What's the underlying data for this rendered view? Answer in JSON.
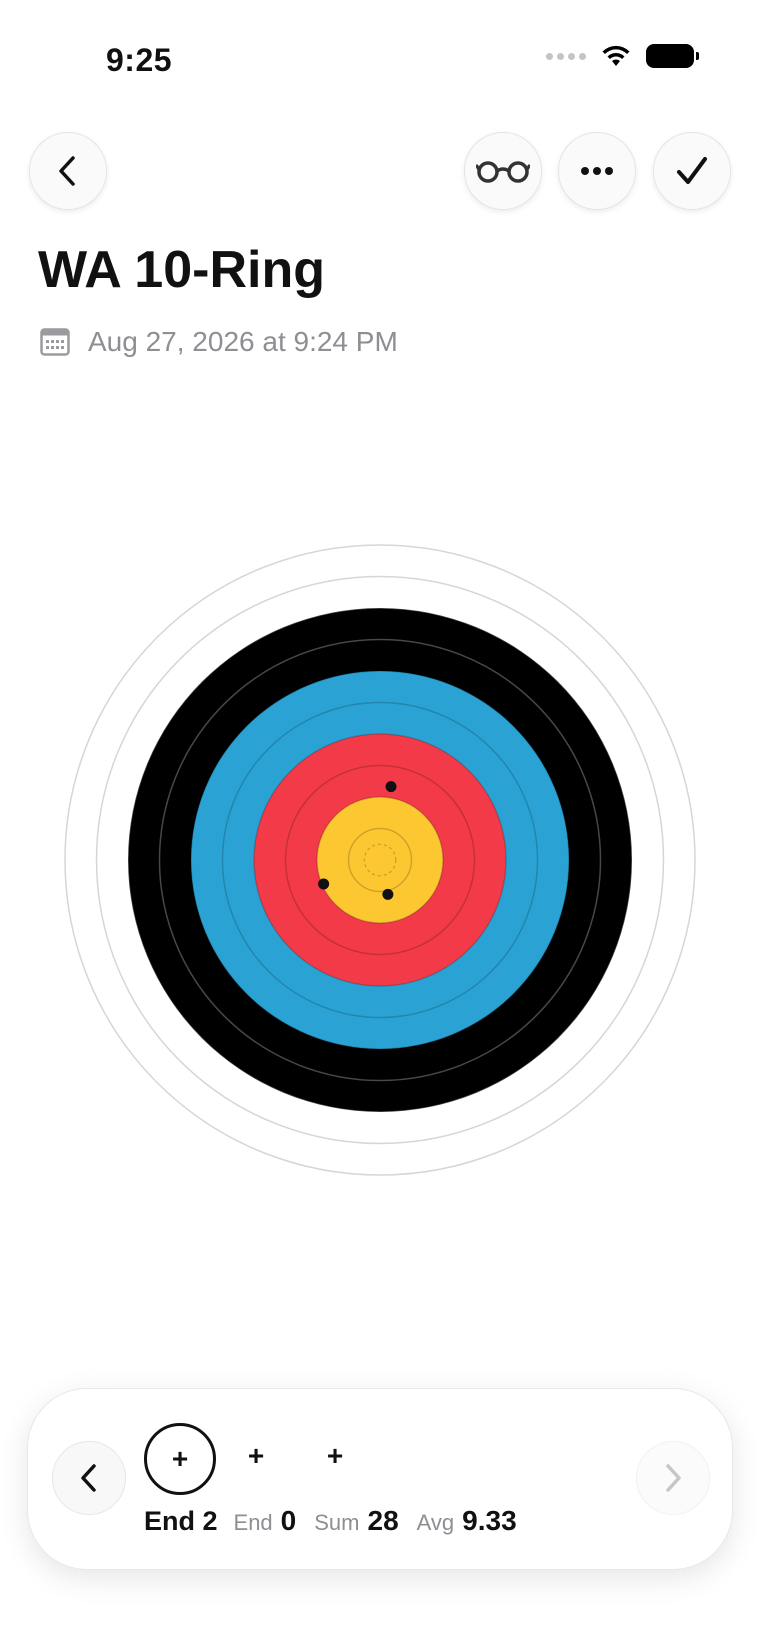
{
  "status_bar": {
    "time": "9:25",
    "icons": [
      "cellular-dots-icon",
      "wifi-icon",
      "battery-icon"
    ]
  },
  "header": {
    "buttons": [
      "back-chevron-icon",
      "glasses-icon",
      "more-ellipsis-icon",
      "checkmark-icon"
    ],
    "title": "WA 10-Ring",
    "date": "Aug 27, 2026 at 9:24 PM"
  },
  "target": {
    "colors": {
      "white": "#ffffff",
      "black": "#000000",
      "blue": "#2aa3d4",
      "red": "#f33a48",
      "gold": "#fdc731"
    },
    "arrows": [
      {
        "x": 0.35,
        "y": 2.33
      },
      {
        "x": -1.79,
        "y": -0.76
      },
      {
        "x": 0.25,
        "y": -1.09
      }
    ]
  },
  "end_panel": {
    "slots": [
      "+",
      "+",
      "+"
    ],
    "current_end": "End 2",
    "end_label": "End",
    "end_value": "0",
    "sum_label": "Sum",
    "sum_value": "28",
    "avg_label": "Avg",
    "avg_value": "9.33"
  }
}
